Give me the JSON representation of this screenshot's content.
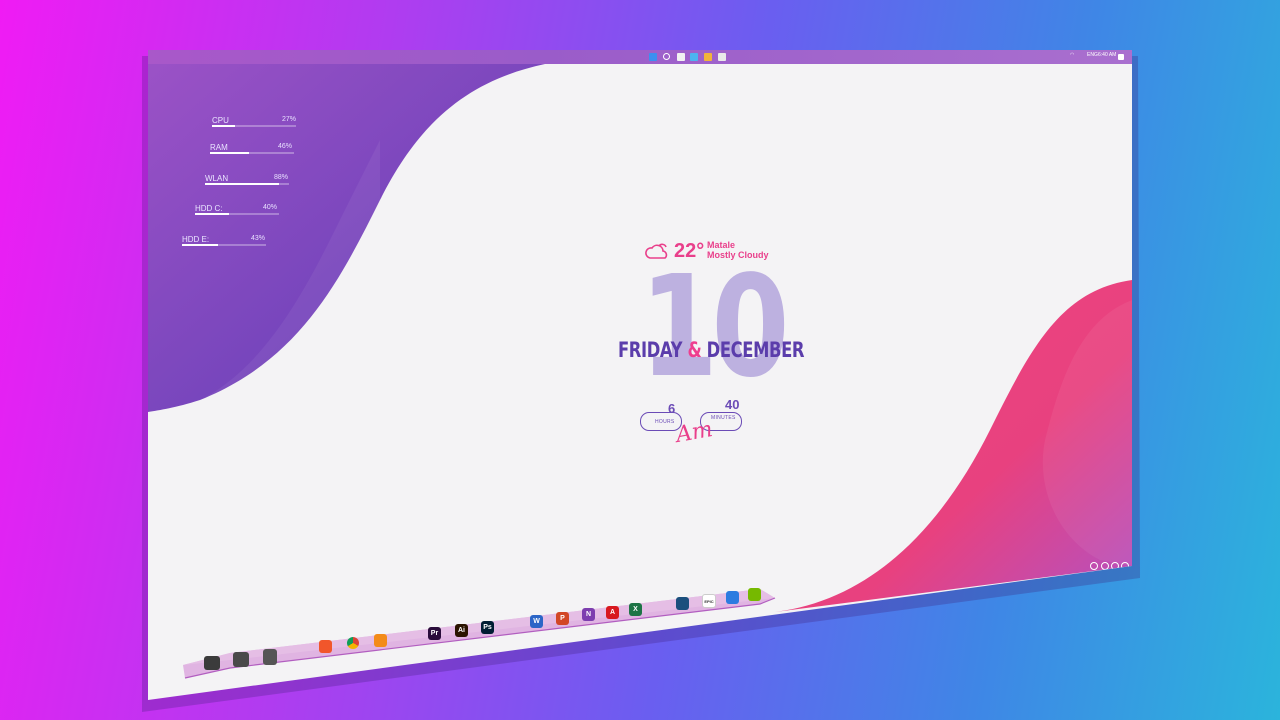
{
  "taskbar": {
    "tray_lang": "ENG",
    "tray_time": "6:40 AM"
  },
  "system_monitor": [
    {
      "label": "CPU",
      "value": "27%",
      "fraction": 0.27
    },
    {
      "label": "RAM",
      "value": "46%",
      "fraction": 0.46
    },
    {
      "label": "WLAN",
      "value": "88%",
      "fraction": 0.88
    },
    {
      "label": "HDD C:",
      "value": "40%",
      "fraction": 0.4
    },
    {
      "label": "HDD E:",
      "value": "43%",
      "fraction": 0.43
    }
  ],
  "weather": {
    "temperature": "22°",
    "city": "Matale",
    "condition": "Mostly Cloudy",
    "icon": "cloud-sun-icon"
  },
  "date": {
    "day": "10",
    "weekday": "FRIDAY",
    "amp": "&",
    "month": "DECEMBER"
  },
  "time": {
    "hours": "6",
    "hours_label": "HOURS",
    "minutes": "40",
    "minutes_label": "MINUTES",
    "ampm": "Am"
  },
  "dock": {
    "left": [
      "this-pc-icon",
      "control-panel-icon",
      "recycle-bin-icon"
    ],
    "apps": [
      {
        "name": "brave-icon",
        "text": "",
        "color": "#f1562b"
      },
      {
        "name": "chrome-icon",
        "text": "",
        "color": "#ffffff"
      },
      {
        "name": "vlc-icon",
        "text": "",
        "color": "#f38b19"
      },
      {
        "name": "premiere-icon",
        "text": "Pr",
        "color": "#2a0c3b"
      },
      {
        "name": "illustrator-icon",
        "text": "Ai",
        "color": "#2b1400"
      },
      {
        "name": "photoshop-icon",
        "text": "Ps",
        "color": "#001d33"
      },
      {
        "name": "word-icon",
        "text": "W",
        "color": "#2b65c7"
      },
      {
        "name": "powerpoint-icon",
        "text": "P",
        "color": "#d24726"
      },
      {
        "name": "onenote-icon",
        "text": "N",
        "color": "#7d3eaf"
      },
      {
        "name": "acrobat-icon",
        "text": "A",
        "color": "#d8191f"
      },
      {
        "name": "excel-icon",
        "text": "X",
        "color": "#1d7446"
      },
      {
        "name": "steam-icon",
        "text": "",
        "color": "#1b4f7d"
      },
      {
        "name": "epic-games-icon",
        "text": "EPIC",
        "color": "#ffffff"
      },
      {
        "name": "uplay-icon",
        "text": "",
        "color": "#2c7be0"
      },
      {
        "name": "nvidia-icon",
        "text": "",
        "color": "#76b900"
      }
    ]
  }
}
